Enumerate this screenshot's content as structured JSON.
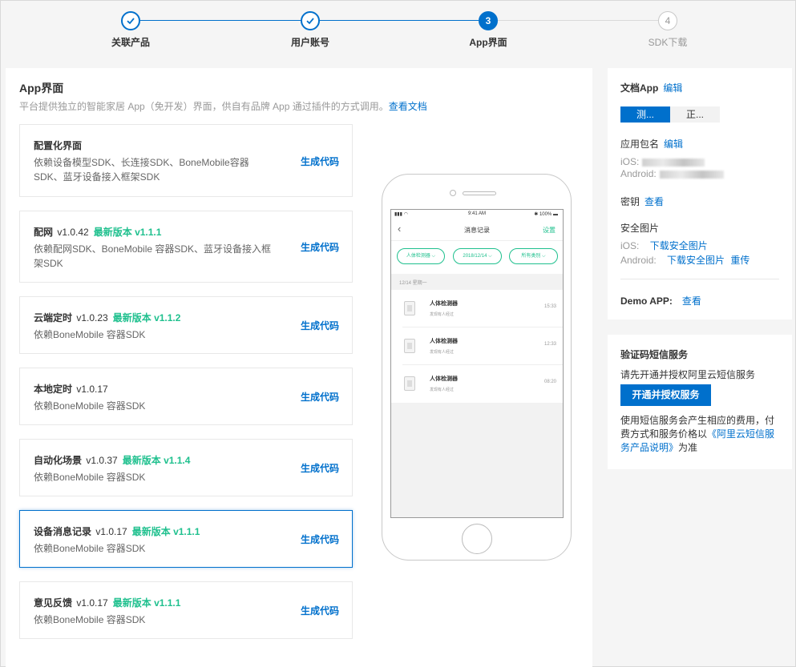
{
  "stepper": {
    "steps": [
      {
        "num": "",
        "label": "关联产品",
        "state": "done"
      },
      {
        "num": "",
        "label": "用户账号",
        "state": "done"
      },
      {
        "num": "3",
        "label": "App界面",
        "state": "active"
      },
      {
        "num": "4",
        "label": "SDK下载",
        "state": "todo"
      }
    ]
  },
  "main": {
    "title": "App界面",
    "desc": "平台提供独立的智能家居 App（免开发）界面，供自有品牌 App 通过插件的方式调用。",
    "doc_link": "查看文档",
    "generate_label": "生成代码",
    "cards": [
      {
        "name": "配置化界面",
        "version": "",
        "latest": "",
        "desc": "依赖设备模型SDK、长连接SDK、BoneMobile容器SDK、蓝牙设备接入框架SDK",
        "selected": false
      },
      {
        "name": "配网",
        "version": "v1.0.42",
        "latest": "最新版本 v1.1.1",
        "desc": "依赖配网SDK、BoneMobile 容器SDK、蓝牙设备接入框架SDK",
        "selected": false
      },
      {
        "name": "云端定时",
        "version": "v1.0.23",
        "latest": "最新版本 v1.1.2",
        "desc": "依赖BoneMobile 容器SDK",
        "selected": false
      },
      {
        "name": "本地定时",
        "version": "v1.0.17",
        "latest": "",
        "desc": "依赖BoneMobile 容器SDK",
        "selected": false
      },
      {
        "name": "自动化场景",
        "version": "v1.0.37",
        "latest": "最新版本 v1.1.4",
        "desc": "依赖BoneMobile 容器SDK",
        "selected": false
      },
      {
        "name": "设备消息记录",
        "version": "v1.0.17",
        "latest": "最新版本 v1.1.1",
        "desc": "依赖BoneMobile 容器SDK",
        "selected": true
      },
      {
        "name": "意见反馈",
        "version": "v1.0.17",
        "latest": "最新版本 v1.1.1",
        "desc": "依赖BoneMobile 容器SDK",
        "selected": false
      }
    ]
  },
  "phone": {
    "status_time": "9:41 AM",
    "status_battery": "100%",
    "nav_title": "消息记录",
    "nav_settings": "设置",
    "filters": [
      "人体检测器",
      "2018/12/14",
      "所有类别"
    ],
    "date_header": "12/14 星期一",
    "messages": [
      {
        "name": "人体检测器",
        "sub": "发现有人经过",
        "time": "15:33"
      },
      {
        "name": "人体检测器",
        "sub": "发现有人经过",
        "time": "12:33"
      },
      {
        "name": "人体检测器",
        "sub": "发现有人经过",
        "time": "08:20"
      }
    ]
  },
  "doc_panel": {
    "title": "文档App",
    "edit": "编辑",
    "tab_test": "测...",
    "tab_prod": "正...",
    "pkg_label": "应用包名",
    "ios_label": "iOS:",
    "android_label": "Android:",
    "key_label": "密钥",
    "view": "查看",
    "secure_img_label": "安全图片",
    "ios_download": "下载安全图片",
    "android_download": "下载安全图片",
    "reupload": "重传",
    "demo_label": "Demo APP:",
    "demo_view": "查看"
  },
  "sms_panel": {
    "title": "验证码短信服务",
    "desc": "请先开通并授权阿里云短信服务",
    "button": "开通并授权服务",
    "note_prefix": "使用短信服务会产生相应的费用，付费方式和服务价格以",
    "note_link": "《阿里云短信服务产品说明》",
    "note_suffix": "为准"
  },
  "colors": {
    "primary": "#0070cc",
    "latest_green": "#1fc08e"
  }
}
